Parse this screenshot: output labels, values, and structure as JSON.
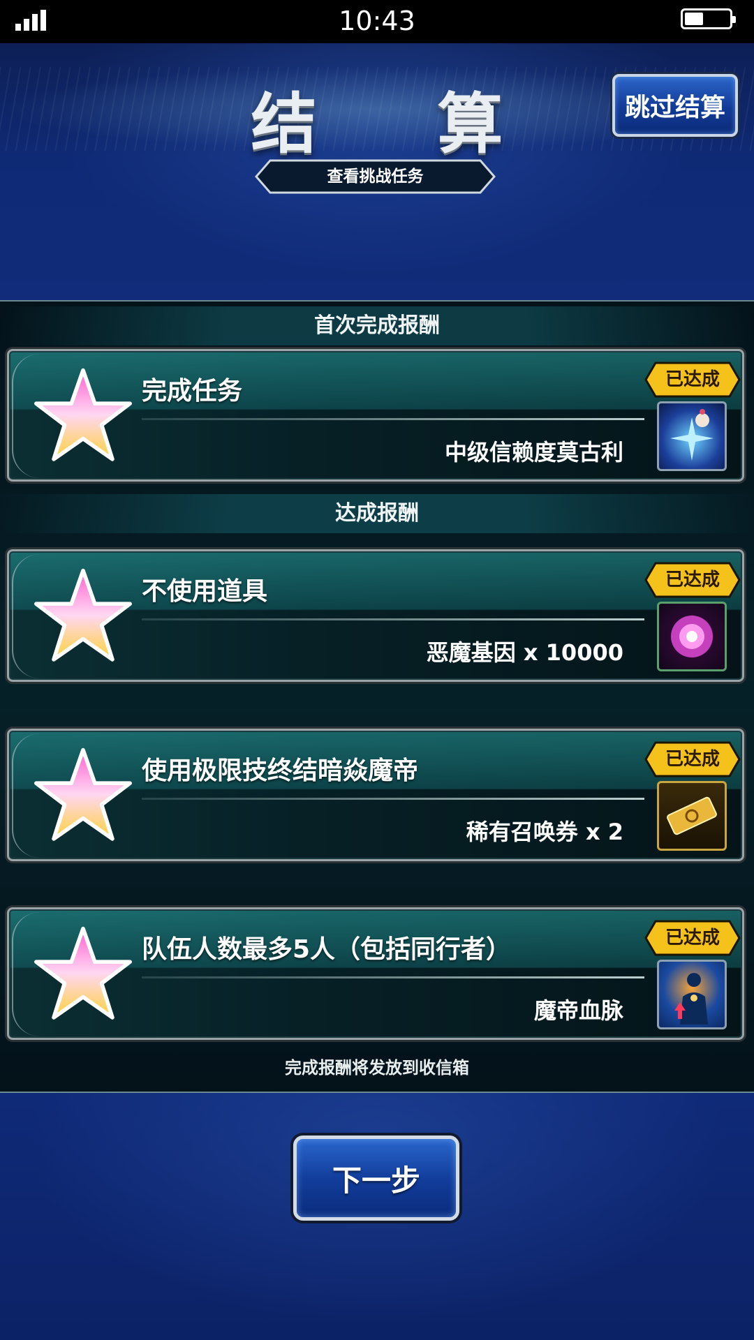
{
  "status_bar": {
    "time": "10:43"
  },
  "header": {
    "title": "结 算",
    "skip_label": "跳过结算",
    "tab_label": "查看挑战任务"
  },
  "sections": {
    "first_clear": "首次完成报酬",
    "achievements": "达成报酬"
  },
  "missions": [
    {
      "name": "完成任务",
      "reward": "中级信赖度莫古利",
      "status": "已达成",
      "icon": "moogle-crystal-icon",
      "icon_color": "#1c3f9a"
    },
    {
      "name": "不使用道具",
      "reward": "恶魔基因 x 10000",
      "status": "已达成",
      "icon": "pink-orb-icon",
      "icon_color": "#3a0b3f"
    },
    {
      "name": "使用极限技终结暗焱魔帝",
      "reward": "稀有召唤券 x 2",
      "status": "已达成",
      "icon": "gold-ticket-icon",
      "icon_color": "#3a2a0a"
    },
    {
      "name": "队伍人数最多5人（包括同行者）",
      "reward": "魔帝血脉",
      "status": "已达成",
      "icon": "bloodline-silhouette-icon",
      "icon_color": "#123a7a"
    }
  ],
  "footer_note": "完成报酬将发放到收信箱",
  "next_label": "下一步",
  "colors": {
    "badge_gold": "#f4c21b",
    "accent_blue": "#1a4aa8",
    "panel_teal": "#0b2f33"
  }
}
